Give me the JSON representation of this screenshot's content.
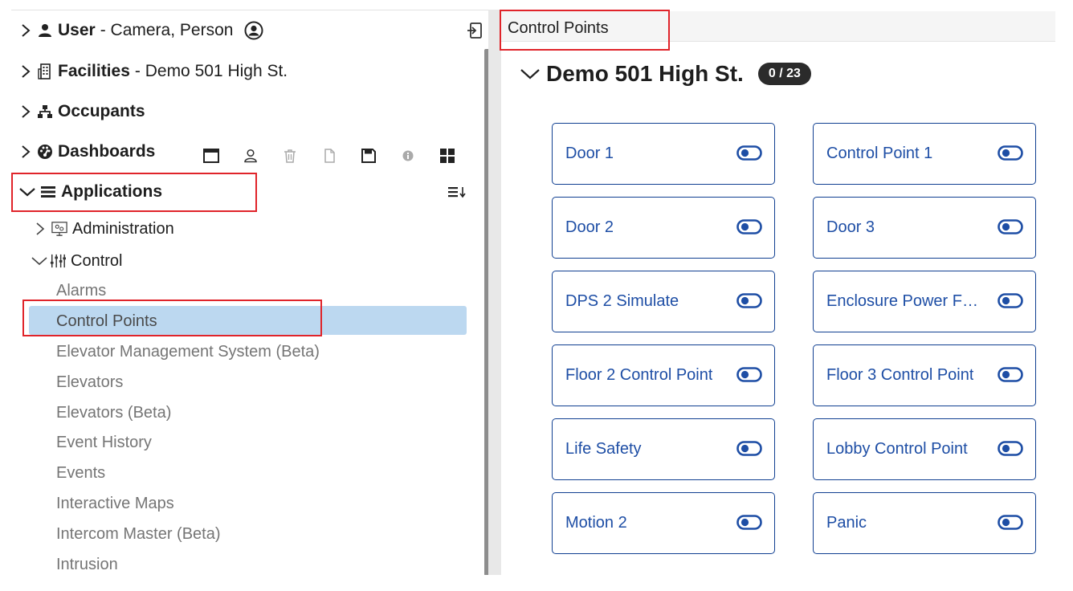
{
  "tree": {
    "user": {
      "label": "User",
      "detail": "- Camera, Person"
    },
    "facilities": {
      "label": "Facilities",
      "detail": "- Demo 501 High St."
    },
    "occupants": {
      "label": "Occupants"
    },
    "dashboards": {
      "label": "Dashboards"
    },
    "applications": {
      "label": "Applications"
    },
    "administration": {
      "label": "Administration"
    },
    "control": {
      "label": "Control"
    },
    "items": [
      {
        "label": "Alarms"
      },
      {
        "label": "Control Points",
        "selected": true
      },
      {
        "label": "Elevator Management System (Beta)"
      },
      {
        "label": "Elevators"
      },
      {
        "label": "Elevators (Beta)"
      },
      {
        "label": "Event History"
      },
      {
        "label": "Events"
      },
      {
        "label": "Interactive Maps"
      },
      {
        "label": "Intercom Master (Beta)"
      },
      {
        "label": "Intrusion"
      }
    ]
  },
  "toolbar_icons": [
    "window-icon",
    "person-outline-icon",
    "trash-icon",
    "copy-icon",
    "save-icon",
    "info-icon",
    "grid-icon"
  ],
  "right": {
    "tab_title": "Control Points",
    "group_title": "Demo 501 High St.",
    "count": "0 / 23",
    "control_points": [
      {
        "label": "Door 1"
      },
      {
        "label": "Control Point 1"
      },
      {
        "label": "Door 2"
      },
      {
        "label": "Door 3"
      },
      {
        "label": "DPS 2 Simulate"
      },
      {
        "label": "Enclosure Power F…"
      },
      {
        "label": "Floor 2 Control Point"
      },
      {
        "label": "Floor 3 Control Point"
      },
      {
        "label": "Life Safety"
      },
      {
        "label": "Lobby Control Point"
      },
      {
        "label": "Motion 2"
      },
      {
        "label": "Panic"
      }
    ]
  },
  "colors": {
    "accent": "#1e4ea5",
    "card_border": "#103f91",
    "selected_bg": "#bcd8f0",
    "highlight_box": "#e0242a",
    "badge_bg": "#2b2b2b"
  }
}
